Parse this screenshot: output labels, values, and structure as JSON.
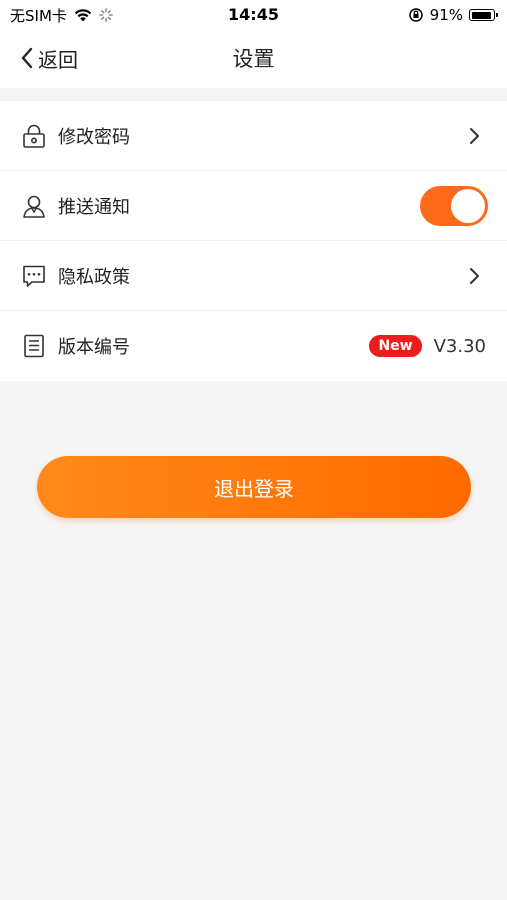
{
  "status_bar": {
    "carrier": "无SIM卡",
    "time": "14:45",
    "battery_percent": "91%",
    "battery_level": 0.91
  },
  "nav": {
    "back_label": "返回",
    "title": "设置"
  },
  "settings": {
    "change_password": {
      "label": "修改密码",
      "icon": "lock-icon"
    },
    "push_notification": {
      "label": "推送通知",
      "icon": "user-icon",
      "enabled": true
    },
    "privacy_policy": {
      "label": "隐私政策",
      "icon": "chat-bubble-icon"
    },
    "version": {
      "label": "版本编号",
      "icon": "document-icon",
      "badge": "New",
      "value": "V3.30"
    }
  },
  "logout": {
    "label": "退出登录"
  },
  "colors": {
    "accent": "#ff6a1a",
    "badge": "#ee1c1c",
    "background": "#f5f5f5"
  }
}
